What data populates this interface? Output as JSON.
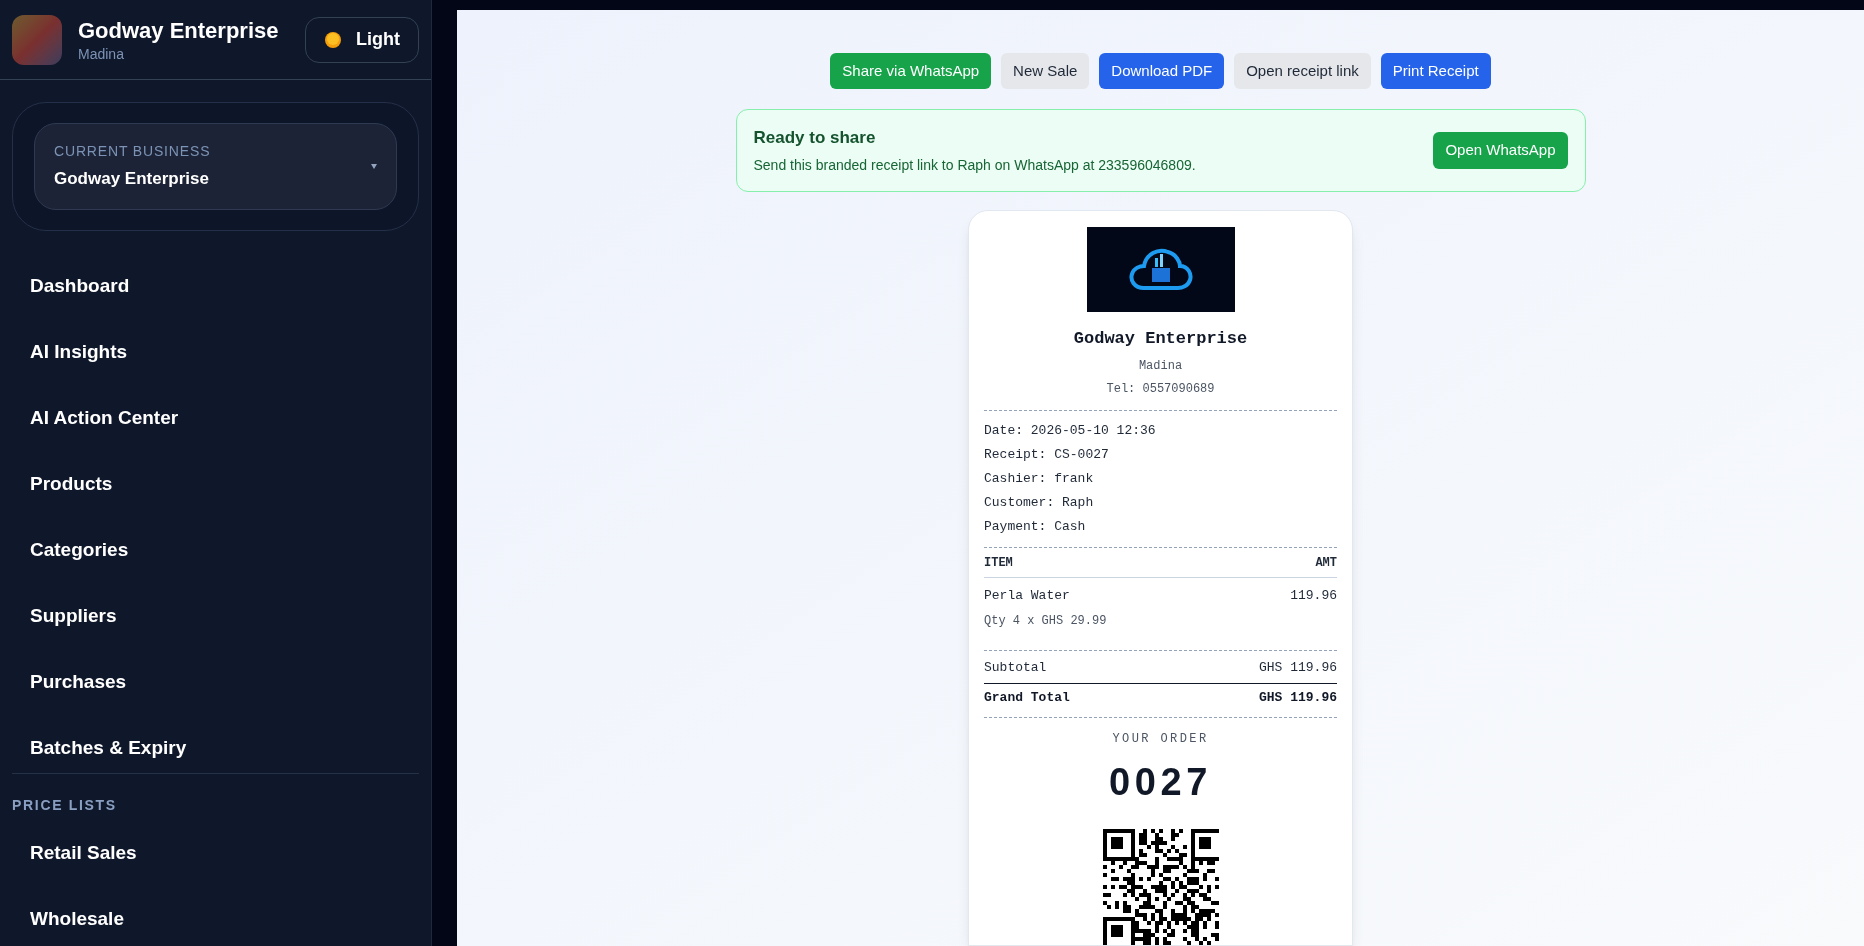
{
  "sidebar": {
    "business_name": "Godway Enterprise",
    "location": "Madina",
    "theme_button": {
      "label": "Light"
    },
    "current_business": {
      "label": "CURRENT BUSINESS",
      "value": "Godway Enterprise"
    },
    "nav_items": [
      {
        "label": "Dashboard"
      },
      {
        "label": "AI Insights"
      },
      {
        "label": "AI Action Center"
      },
      {
        "label": "Products"
      },
      {
        "label": "Categories"
      },
      {
        "label": "Suppliers"
      },
      {
        "label": "Purchases"
      },
      {
        "label": "Batches & Expiry"
      }
    ],
    "price_lists": {
      "heading": "PRICE LISTS",
      "items": [
        {
          "label": "Retail Sales"
        },
        {
          "label": "Wholesale"
        }
      ]
    }
  },
  "actions": [
    {
      "label": "Share via WhatsApp",
      "kind": "success"
    },
    {
      "label": "New Sale",
      "kind": "secondary"
    },
    {
      "label": "Download PDF",
      "kind": "primary"
    },
    {
      "label": "Open receipt link",
      "kind": "secondary"
    },
    {
      "label": "Print Receipt",
      "kind": "primary"
    }
  ],
  "share_banner": {
    "title": "Ready to share",
    "message": "Send this branded receipt link to Raph on WhatsApp at 233596046809.",
    "button": "Open WhatsApp"
  },
  "receipt": {
    "business_name": "Godway Enterprise",
    "location": "Madina",
    "phone": "Tel: 0557090689",
    "details": [
      "Date: 2026-05-10 12:36",
      "Receipt: CS-0027",
      "Cashier: frank",
      "Customer: Raph",
      "Payment: Cash"
    ],
    "columns": {
      "item": "ITEM",
      "amount": "AMT"
    },
    "items": [
      {
        "name": "Perla Water",
        "detail": "Qty 4 x GHS 29.99",
        "amount": "119.96"
      }
    ],
    "subtotal": {
      "label": "Subtotal",
      "value": "GHS 119.96"
    },
    "grand_total": {
      "label": "Grand Total",
      "value": "GHS 119.96"
    },
    "order_label": "YOUR ORDER",
    "order_number": "0027"
  }
}
